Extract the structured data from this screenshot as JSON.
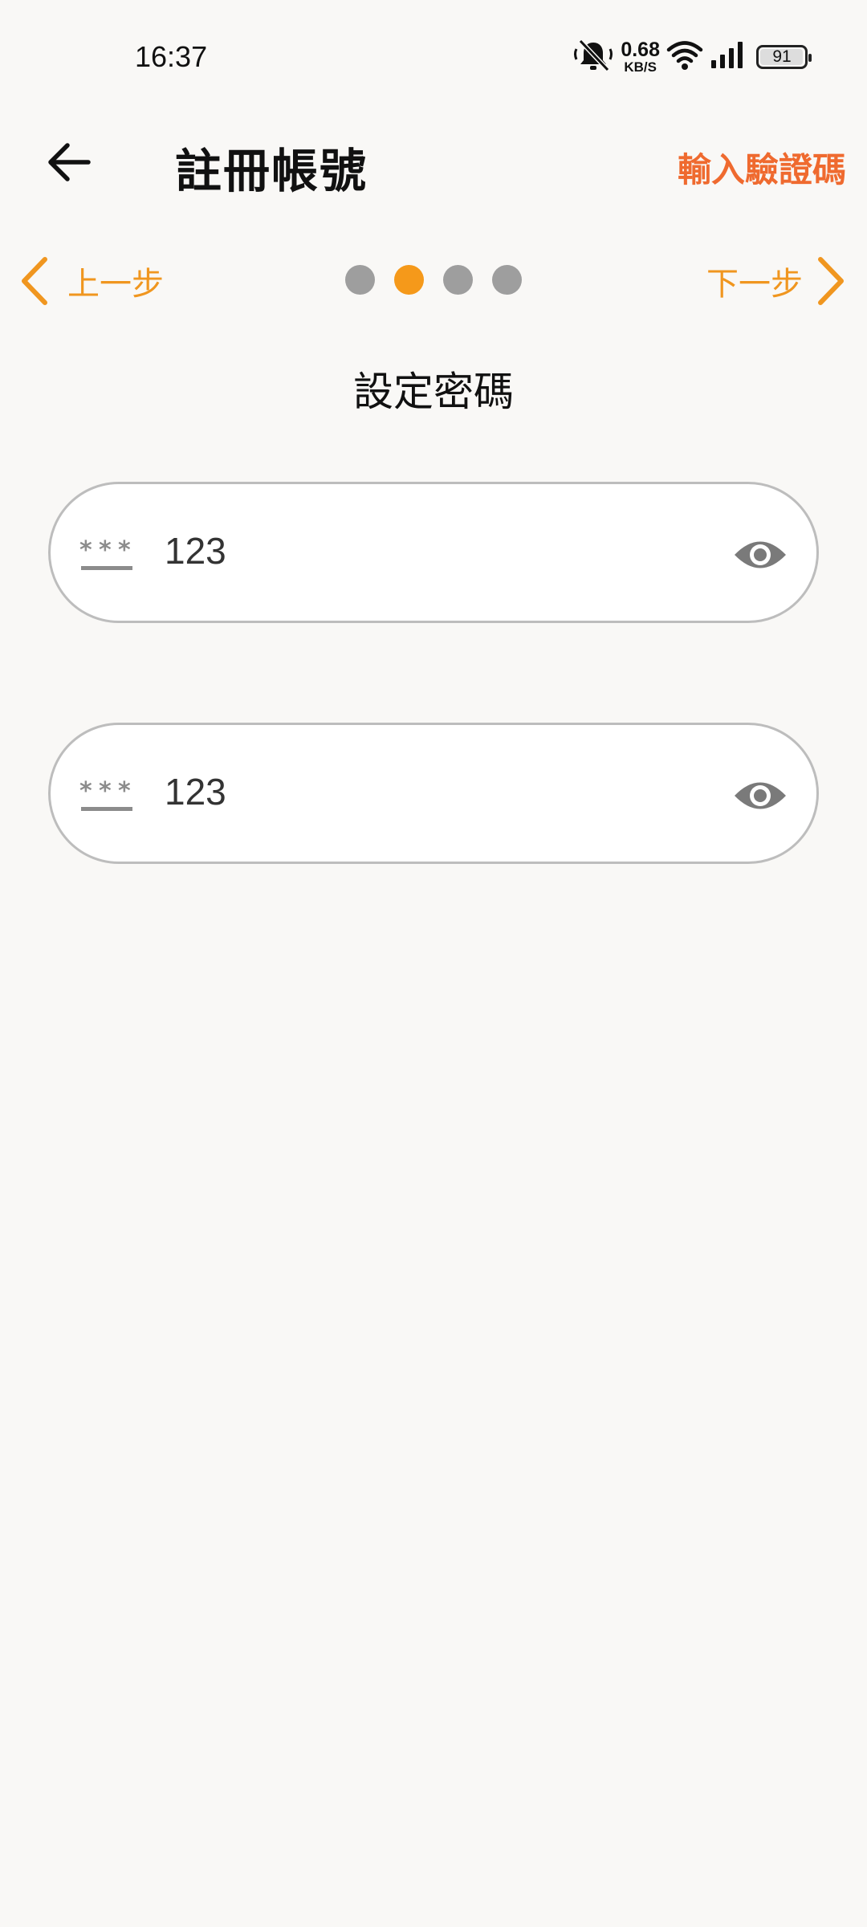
{
  "status_bar": {
    "time": "16:37",
    "net_speed_value": "0.68",
    "net_speed_unit": "KB/S",
    "battery_level": "91",
    "icons": [
      "mute-icon",
      "wifi-icon",
      "signal-icon",
      "battery-icon"
    ]
  },
  "header": {
    "title": "註冊帳號",
    "action_label": "輸入驗證碼",
    "back_icon": "arrow-left-icon"
  },
  "step_nav": {
    "prev_label": "上一步",
    "next_label": "下一步",
    "total_steps": 4,
    "current_step": 2
  },
  "section": {
    "title": "設定密碼"
  },
  "password_fields": [
    {
      "value": "123",
      "leading_icon": "password-icon",
      "toggle_icon": "eye-icon"
    },
    {
      "value": "123",
      "leading_icon": "password-icon",
      "toggle_icon": "eye-icon"
    }
  ],
  "colors": {
    "accent_orange": "#f0961f",
    "action_orange": "#ef6a2f",
    "dot_active": "#f5991a",
    "dot_inactive": "#9e9e9e",
    "background": "#f9f8f6",
    "field_border": "#bdbdbd"
  }
}
